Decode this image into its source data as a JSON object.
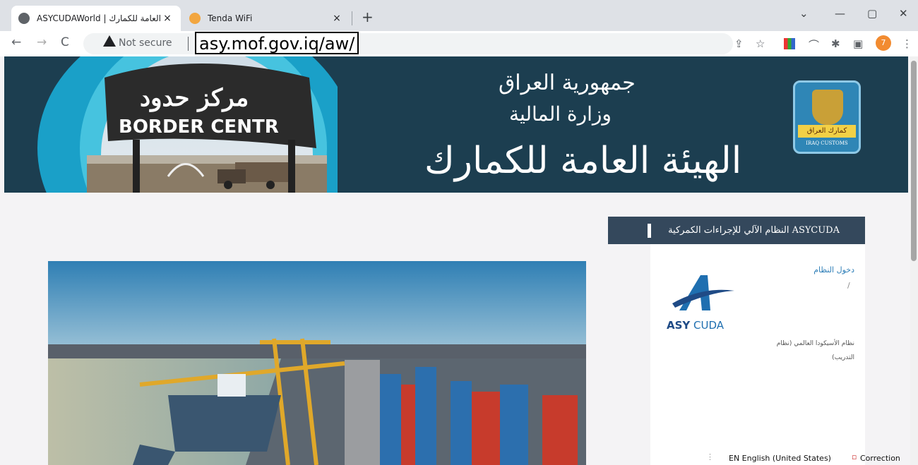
{
  "browser": {
    "tabs": [
      {
        "title": "ASYCUDAWorld | الهيئة العامة للكمارك",
        "active": true
      },
      {
        "title": "Tenda WiFi",
        "active": false
      }
    ],
    "close_glyph": "×",
    "new_tab_glyph": "+",
    "window_controls": {
      "minimize": "—",
      "maximize": "▢",
      "close": "✕",
      "dropdown": "⌄"
    },
    "nav": {
      "back": "←",
      "forward": "→",
      "reload": "C"
    },
    "security_label": "Not secure",
    "url": "asy.mof.gov.iq/aw/",
    "profile_initial": "7"
  },
  "banner": {
    "line1": "جمهورية العراق",
    "line2": "وزارة المالية",
    "line3": "الهيئة العامة للكمارك",
    "sign_arabic": "مركز حدود",
    "sign_english": "BORDER CENTR",
    "emblem_arabic": "كمارك العراق",
    "emblem_english": "IRAQ CUSTOMS"
  },
  "panel": {
    "header": "ASYCUDA النظام الآلي للإجراءات الكمركية",
    "login_link": "دخول النظام",
    "slash": "/",
    "logo_text_bold": "ASY",
    "logo_text": "CUDA",
    "description": "نظام الأسيكودا العالمي (نظام التدريب)"
  },
  "taskbar": {
    "language": "EN English (United States)",
    "correction": "Correction"
  },
  "colors": {
    "banner_bg": "#1c3e50",
    "panel_header": "#34485c",
    "link": "#2f7fb8",
    "page_bg": "#f4f3f5"
  }
}
